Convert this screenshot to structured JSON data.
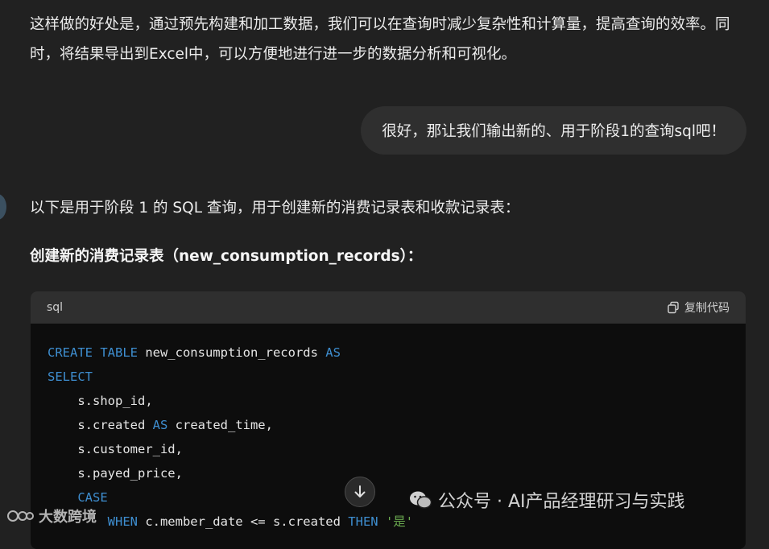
{
  "assistant_intro": {
    "paragraph": "这样做的好处是，通过预先构建和加工数据，我们可以在查询时减少复杂性和计算量，提高查询的效率。同时，将结果导出到Excel中，可以方便地进行进一步的数据分析和可视化。"
  },
  "user_message": {
    "text": "很好，那让我们输出新的、用于阶段1的查询sql吧！"
  },
  "assistant_reply": {
    "intro": "以下是用于阶段 1 的 SQL 查询，用于创建新的消费记录表和收款记录表：",
    "heading": "创建新的消费记录表（new_consumption_records）："
  },
  "code_block": {
    "language": "sql",
    "copy_label": "复制代码",
    "lines": [
      {
        "indent": "",
        "parts": [
          [
            "kw",
            "CREATE TABLE"
          ],
          [
            "txt",
            " new_consumption_records "
          ],
          [
            "kw",
            "AS"
          ]
        ]
      },
      {
        "indent": "",
        "parts": [
          [
            "kw",
            "SELECT"
          ]
        ]
      },
      {
        "indent": "    ",
        "parts": [
          [
            "txt",
            "s.shop_id,"
          ]
        ]
      },
      {
        "indent": "    ",
        "parts": [
          [
            "txt",
            "s.created "
          ],
          [
            "kw",
            "AS"
          ],
          [
            "txt",
            " created_time,"
          ]
        ]
      },
      {
        "indent": "    ",
        "parts": [
          [
            "txt",
            "s.customer_id,"
          ]
        ]
      },
      {
        "indent": "    ",
        "parts": [
          [
            "txt",
            "s.payed_price,"
          ]
        ]
      },
      {
        "indent": "    ",
        "parts": [
          [
            "kw",
            "CASE"
          ]
        ]
      },
      {
        "indent": "        ",
        "parts": [
          [
            "kw",
            "WHEN"
          ],
          [
            "txt",
            " c.member_date <= s.created "
          ],
          [
            "kw",
            "THEN"
          ],
          [
            "txt",
            " "
          ],
          [
            "str",
            "'是'"
          ]
        ]
      }
    ]
  },
  "watermarks": {
    "left": "大数跨境",
    "right": "公众号 · AI产品经理研习与实践"
  },
  "colors": {
    "background": "#212121",
    "keyword": "#3e8ed0",
    "string": "#6aa84f"
  }
}
